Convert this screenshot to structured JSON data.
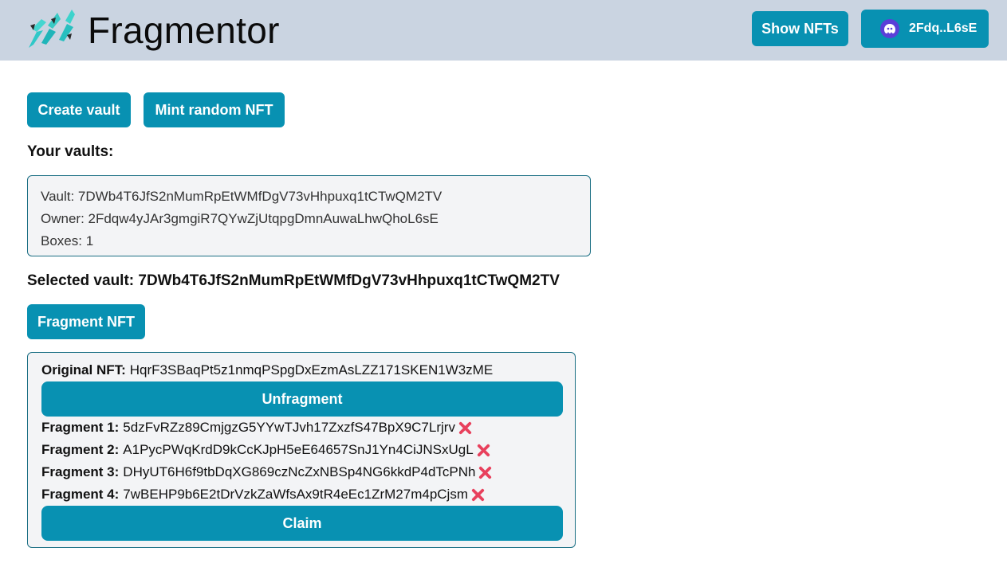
{
  "header": {
    "app_title": "Fragmentor",
    "logo_icon": "crystal-shards-icon",
    "show_nfts_label": "Show NFTs",
    "wallet_label": "2Fdq..L6sE",
    "wallet_icon": "phantom-ghost-icon"
  },
  "actions": {
    "create_vault_label": "Create vault",
    "mint_random_nft_label": "Mint random NFT",
    "fragment_nft_label": "Fragment NFT"
  },
  "vaults": {
    "heading": "Your vaults:",
    "items": [
      {
        "vault": "Vault: 7DWb4T6JfS2nMumRpEtWMfDgV73vHhpuxq1tCTwQM2TV",
        "owner": "Owner: 2Fdqw4yJAr3gmgiR7QYwZjUtqpgDmnAuwaLhwQhoL6sE",
        "boxes": "Boxes: 1"
      }
    ]
  },
  "selected_vault": {
    "text": "Selected vault: 7DWb4T6JfS2nMumRpEtWMfDgV73vHhpuxq1tCTwQM2TV"
  },
  "nft_box": {
    "original_label": "Original NFT:",
    "original_value": "HqrF3SBaqPt5z1nmqPSpgDxEzmAsLZZ171SKEN1W3zME",
    "unfragment_label": "Unfragment",
    "claim_label": "Claim",
    "fragments": [
      {
        "label": "Fragment 1:",
        "value": "5dzFvRZz89CmjgzG5YYwTJvh17ZxzfS47BpX9C7Lrjrv",
        "status_icon": "cross-mark-icon"
      },
      {
        "label": "Fragment 2:",
        "value": "A1PycPWqKrdD9kCcKJpH5eE64657SnJ1Yn4CiJNSxUgL",
        "status_icon": "cross-mark-icon"
      },
      {
        "label": "Fragment 3:",
        "value": "DHyUT6H6f9tbDqXG869czNcZxNBSp4NG6kkdP4dTcPNh",
        "status_icon": "cross-mark-icon"
      },
      {
        "label": "Fragment 4:",
        "value": "7wBEHP9b6E2tDrVzkZaWfsAx9tR4eEc1ZrM27m4pCjsm",
        "status_icon": "cross-mark-icon"
      }
    ]
  },
  "colors": {
    "header_bg": "#cad4e1",
    "button": "#0891b2",
    "card_bg": "#f3f4f6",
    "card_border": "#1b6f84",
    "cross": "#e8405c",
    "wallet_icon_bg": "#5a3fd8"
  }
}
